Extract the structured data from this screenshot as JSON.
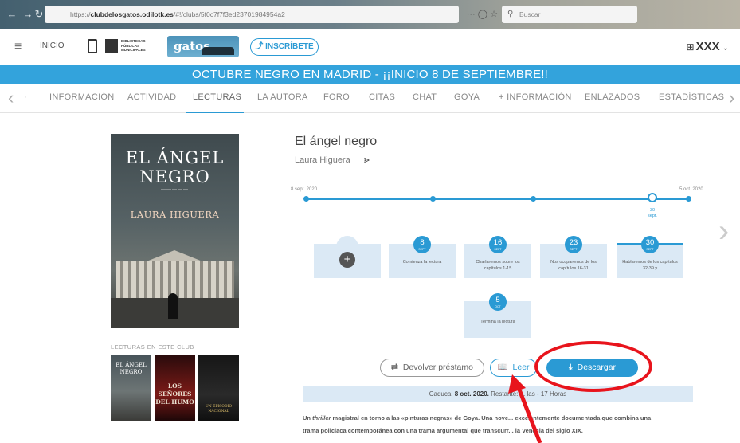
{
  "browser": {
    "url_prefix": "https://",
    "url_domain": "clubdelosgatos.odilotk.es",
    "url_path": "/#!/clubs/5f0c7f7f3ed23701984954a2",
    "menu_dots": "···",
    "search_placeholder": "Buscar"
  },
  "header": {
    "inicio": "INICIO",
    "bibliotecas_text": "BIBLIOTECAS PÚBLICAS MUNICIPALES",
    "gatos_logo": "gatos",
    "inscribete": "INSCRÍBETE",
    "user": "XXX"
  },
  "banner": "OCTUBRE NEGRO EN MADRID - ¡¡INICIO 8 DE SEPTIEMBRE!!",
  "tabs": [
    "INFORMACIÓN",
    "ACTIVIDAD",
    "LECTURAS",
    "LA AUTORA",
    "FORO",
    "CITAS",
    "CHAT",
    "GOYA",
    "+ INFORMACIÓN",
    "ENLAZADOS",
    "ESTADÍSTICAS"
  ],
  "active_tab": "LECTURAS",
  "cover": {
    "line1": "EL ÁNGEL",
    "line2": "NEGRO",
    "author": "LAURA HIGUERA"
  },
  "club_label": "LECTURAS EN ESTE CLUB",
  "thumbnails": [
    {
      "text": "EL ÁNGEL NEGRO"
    },
    {
      "text": "LOS SEÑORES DEL HUMO"
    },
    {
      "text": "UN EPISODIO NACIONAL"
    }
  ],
  "book": {
    "title": "El ángel negro",
    "author": "Laura Higuera"
  },
  "timeline": {
    "start": "8 sept. 2020",
    "end": "5 oct. 2020",
    "current_day": "30",
    "current_month": "sept."
  },
  "cards": [
    {
      "day": "8",
      "month": "SEPT",
      "text": "Comienza la lectura"
    },
    {
      "day": "16",
      "month": "SEPT",
      "text": "Charlaremos sobre los capítulos 1-15"
    },
    {
      "day": "23",
      "month": "SEPT",
      "text": "Nos ocuparemos de los capítulos 16-31"
    },
    {
      "day": "30",
      "month": "SEPT",
      "text": "Hablaremos de los capítulos 32-39 y"
    },
    {
      "day": "5",
      "month": "OCT",
      "text": "Termina la lectura"
    }
  ],
  "buttons": {
    "return_label": "Devolver préstamo",
    "read_label": "Leer",
    "download_label": "Descargar"
  },
  "expire": {
    "prefix": "Caduca:",
    "date": "8 oct. 2020.",
    "remaining": "Restante: ... las - 17 Horas"
  },
  "synopsis": {
    "line1_a": "Un",
    "line1_em": "thriller",
    "line1_b": "magistral en torno a las «pinturas negras» de Goya. Una nove... excelentemente documentada que combina una",
    "line2": "trama policiaca contemporánea con una trama argumental que transcurr... la Venecia del siglo XIX."
  },
  "colors": {
    "accent": "#2a9ad4",
    "banner": "#33a3dc",
    "highlight": "#e8141c"
  }
}
